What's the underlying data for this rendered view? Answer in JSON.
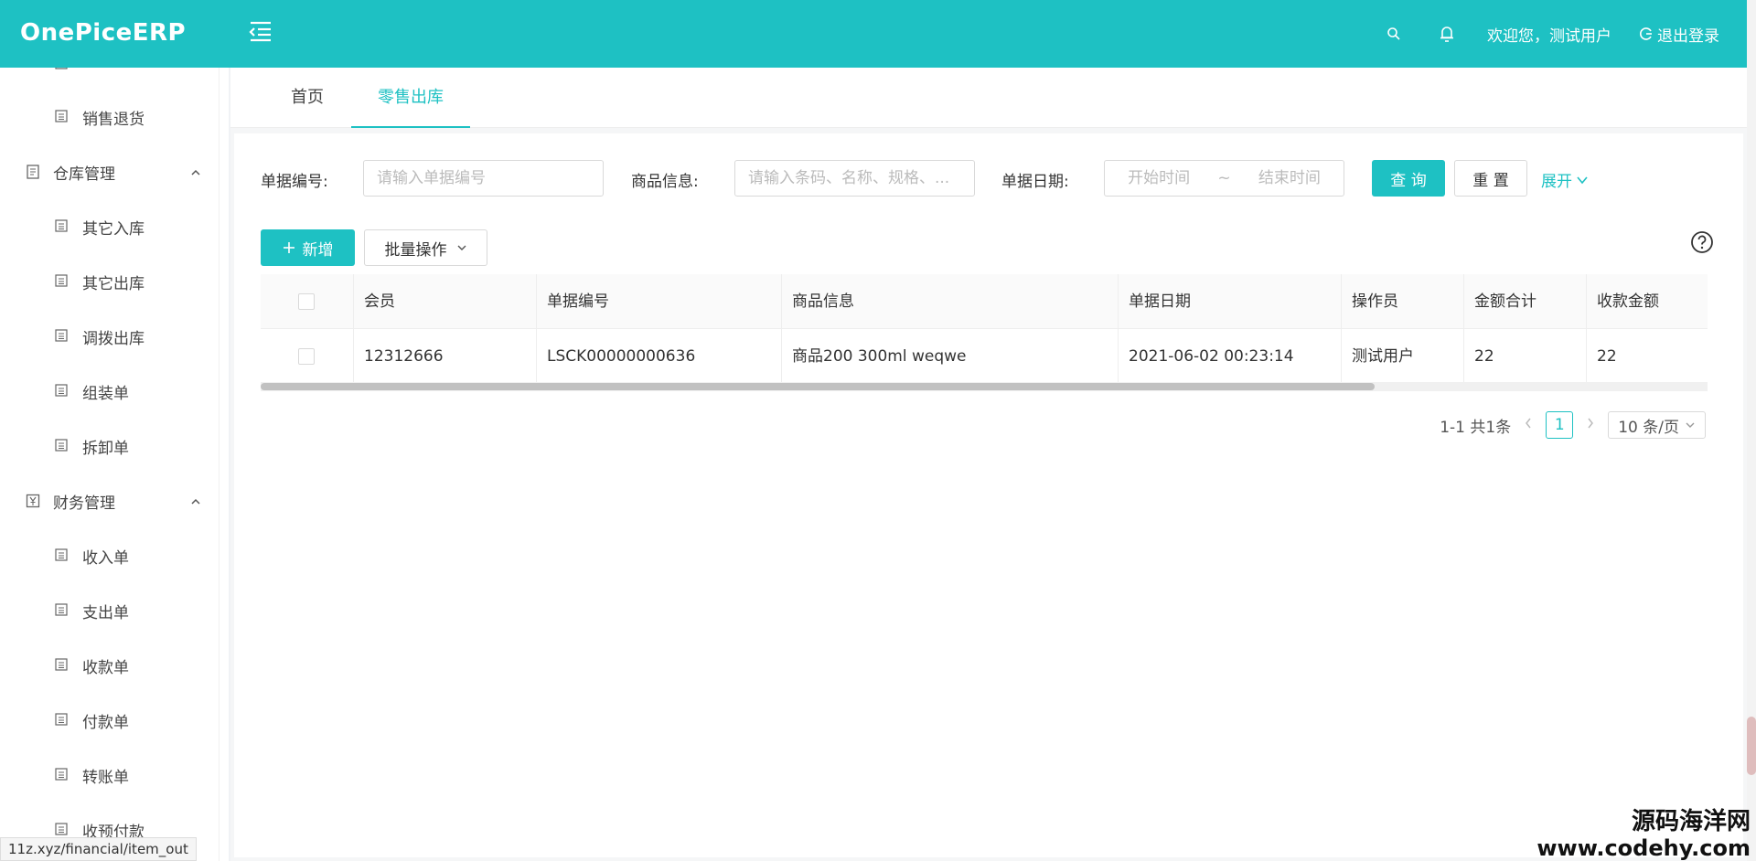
{
  "header": {
    "logo": "OnePiceERP",
    "welcome": "欢迎您，测试用户",
    "logout_label": "退出登录",
    "bg_color": "#1ec1c3"
  },
  "sidebar": {
    "items": [
      {
        "label": "销售退货",
        "type": "sub"
      },
      {
        "label": "仓库管理",
        "type": "group"
      },
      {
        "label": "其它入库",
        "type": "sub"
      },
      {
        "label": "其它出库",
        "type": "sub"
      },
      {
        "label": "调拨出库",
        "type": "sub"
      },
      {
        "label": "组装单",
        "type": "sub"
      },
      {
        "label": "拆卸单",
        "type": "sub"
      },
      {
        "label": "财务管理",
        "type": "group"
      },
      {
        "label": "收入单",
        "type": "sub"
      },
      {
        "label": "支出单",
        "type": "sub"
      },
      {
        "label": "收款单",
        "type": "sub"
      },
      {
        "label": "付款单",
        "type": "sub"
      },
      {
        "label": "转账单",
        "type": "sub"
      },
      {
        "label": "收预付款",
        "type": "sub"
      }
    ]
  },
  "tabs": [
    {
      "label": "首页",
      "active": false
    },
    {
      "label": "零售出库",
      "active": true
    }
  ],
  "filters": {
    "bill_no_label": "单据编号:",
    "bill_no_placeholder": "请输入单据编号",
    "goods_label": "商品信息:",
    "goods_placeholder": "请输入条码、名称、规格、...",
    "date_label": "单据日期:",
    "start_placeholder": "开始时间",
    "range_sep": "~",
    "end_placeholder": "结束时间",
    "query_label": "查 询",
    "reset_label": "重 置",
    "expand_label": "展开"
  },
  "toolbar": {
    "add_label": "新增",
    "batch_label": "批量操作"
  },
  "table": {
    "columns": [
      "会员",
      "单据编号",
      "商品信息",
      "单据日期",
      "操作员",
      "金额合计",
      "收款金额"
    ],
    "rows": [
      [
        "12312666",
        "LSCK00000000636",
        "商品200 300ml weqwe",
        "2021-06-02 00:23:14",
        "测试用户",
        "22",
        "22"
      ]
    ]
  },
  "pagination": {
    "summary": "1-1 共1条",
    "current_page": "1",
    "page_size": "10 条/页"
  },
  "status_url": "11z.xyz/financial/item_out",
  "watermark": {
    "line1": "源码海洋网",
    "line2": "www.codehy.com"
  }
}
